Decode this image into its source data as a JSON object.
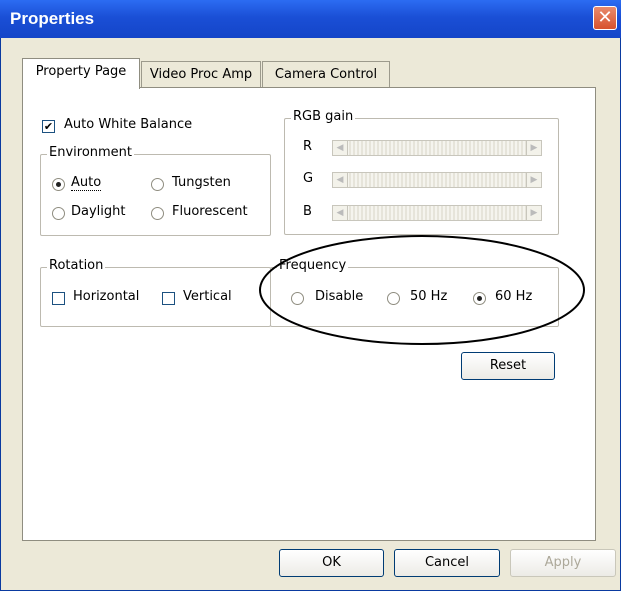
{
  "window": {
    "title": "Properties",
    "close_label": "✕"
  },
  "tabs": [
    {
      "label": "Property Page",
      "active": true
    },
    {
      "label": "Video Proc Amp",
      "active": false
    },
    {
      "label": "Camera Control",
      "active": false
    }
  ],
  "auto_white_balance": {
    "label": "Auto White Balance",
    "checked": true
  },
  "environment": {
    "label": "Environment",
    "options": [
      {
        "label": "Auto",
        "selected": true
      },
      {
        "label": "Tungsten",
        "selected": false
      },
      {
        "label": "Daylight",
        "selected": false
      },
      {
        "label": "Fluorescent",
        "selected": false
      }
    ]
  },
  "rgb_gain": {
    "label": "RGB gain",
    "channels": [
      {
        "label": "R"
      },
      {
        "label": "G"
      },
      {
        "label": "B"
      }
    ]
  },
  "rotation": {
    "label": "Rotation",
    "options": [
      {
        "label": "Horizontal",
        "checked": false
      },
      {
        "label": "Vertical",
        "checked": false
      }
    ]
  },
  "frequency": {
    "label": "Frequency",
    "options": [
      {
        "label": "Disable",
        "selected": false
      },
      {
        "label": "50 Hz",
        "selected": false
      },
      {
        "label": "60 Hz",
        "selected": true
      }
    ]
  },
  "buttons": {
    "reset": "Reset",
    "ok": "OK",
    "cancel": "Cancel",
    "apply": "Apply"
  }
}
